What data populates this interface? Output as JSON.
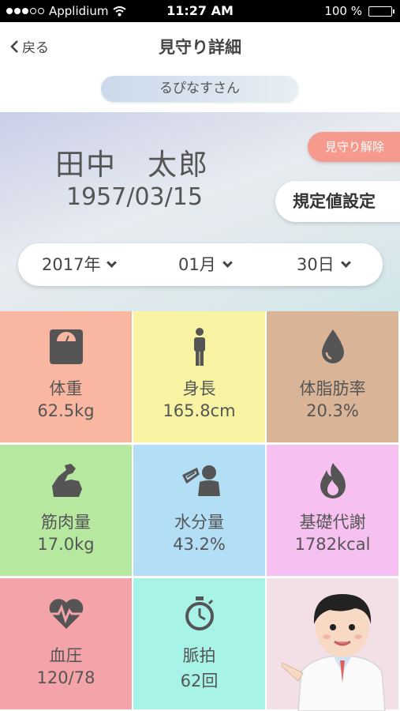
{
  "statusbar": {
    "carrier": "Applidium",
    "time": "11:27 AM",
    "battery": "100 %"
  },
  "nav": {
    "back_label": "戻る",
    "title": "見守り詳細"
  },
  "user": {
    "name_label": "るぴなすさん"
  },
  "profile": {
    "name": "田中　太郎",
    "dob": "1957/03/15"
  },
  "actions": {
    "release_label": "見守り解除",
    "setting_label": "規定値設定"
  },
  "date": {
    "year": "2017年",
    "month": "01月",
    "day": "30日"
  },
  "metrics": [
    {
      "label": "体重",
      "value": "62.5kg",
      "icon": "scale-icon",
      "color": "#f9b6a0"
    },
    {
      "label": "身長",
      "value": "165.8cm",
      "icon": "person-icon",
      "color": "#f8f2a3"
    },
    {
      "label": "体脂肪率",
      "value": "20.3%",
      "icon": "drop-icon",
      "color": "#d9b497"
    },
    {
      "label": "筋肉量",
      "value": "17.0kg",
      "icon": "muscle-icon",
      "color": "#b7e8a0"
    },
    {
      "label": "水分量",
      "value": "43.2%",
      "icon": "drinking-icon",
      "color": "#b2def6"
    },
    {
      "label": "基礎代謝",
      "value": "1782kcal",
      "icon": "flame-icon",
      "color": "#f6c1f0"
    },
    {
      "label": "血圧",
      "value": "120/78",
      "icon": "heartbeat-icon",
      "color": "#f4a4a8"
    },
    {
      "label": "脈拍",
      "value": "62回",
      "icon": "stopwatch-icon",
      "color": "#a7f3e8"
    }
  ],
  "doctor_cell_color": "#f3e0e6"
}
